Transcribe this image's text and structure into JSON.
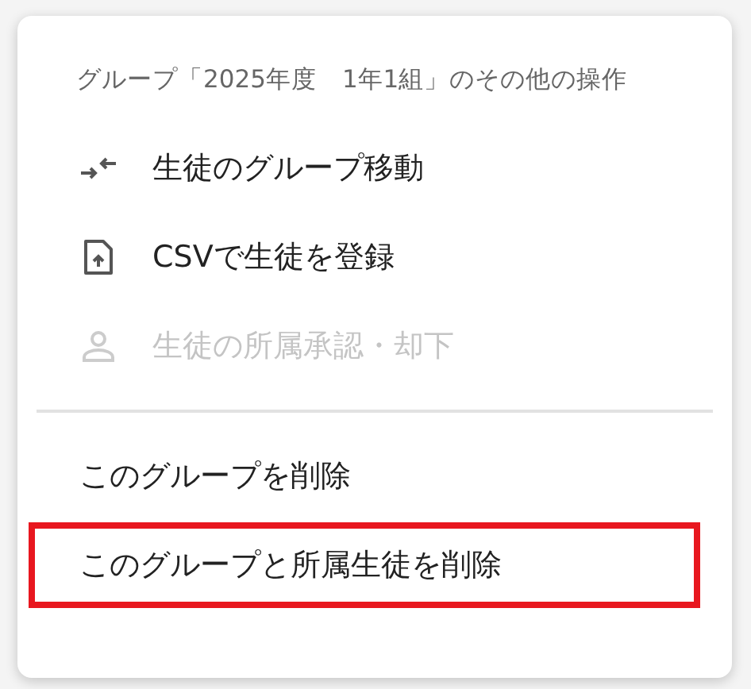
{
  "menu": {
    "title": "グループ「2025年度　1年1組」のその他の操作",
    "groups": [
      [
        {
          "kind": "move",
          "label": "生徒のグループ移動",
          "disabled": false,
          "highlighted": false
        },
        {
          "kind": "upload",
          "label": "CSVで生徒を登録",
          "disabled": false,
          "highlighted": false
        },
        {
          "kind": "person",
          "label": "生徒の所属承認・却下",
          "disabled": true,
          "highlighted": false
        }
      ],
      [
        {
          "kind": "plain",
          "label": "このグループを削除",
          "disabled": false,
          "highlighted": false
        },
        {
          "kind": "plain",
          "label": "このグループと所属生徒を削除",
          "disabled": false,
          "highlighted": true
        }
      ]
    ]
  }
}
